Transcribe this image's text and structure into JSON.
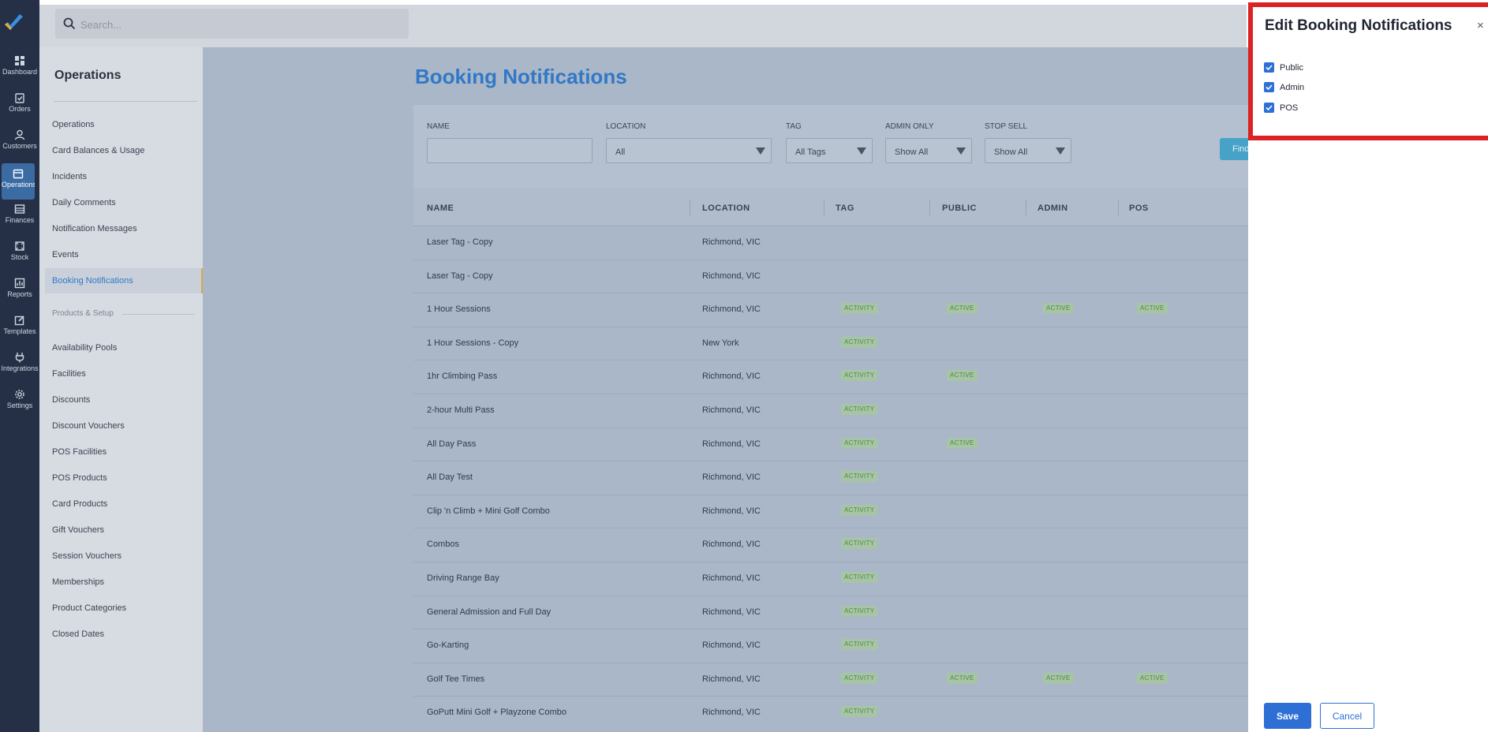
{
  "rail": {
    "items": [
      {
        "label": "Dashboard",
        "icon": "dashboard-icon"
      },
      {
        "label": "Orders",
        "icon": "orders-icon"
      },
      {
        "label": "Customers",
        "icon": "user-icon"
      },
      {
        "label": "Operations",
        "icon": "calendar-icon"
      },
      {
        "label": "Finances",
        "icon": "finance-icon"
      },
      {
        "label": "Stock",
        "icon": "stock-icon"
      },
      {
        "label": "Reports",
        "icon": "reports-icon"
      },
      {
        "label": "Templates",
        "icon": "edit-icon"
      },
      {
        "label": "Integrations",
        "icon": "plug-icon"
      },
      {
        "label": "Settings",
        "icon": "gear-icon"
      }
    ]
  },
  "search": {
    "placeholder": "Search..."
  },
  "subnav": {
    "title": "Operations",
    "items": [
      "Operations",
      "Card Balances & Usage",
      "Incidents",
      "Daily Comments",
      "Notification Messages",
      "Events",
      "Booking Notifications"
    ],
    "section_label": "Products & Setup",
    "setup_items": [
      "Availability Pools",
      "Facilities",
      "Discounts",
      "Discount Vouchers",
      "POS Facilities",
      "POS Products",
      "Card Products",
      "Gift Vouchers",
      "Session Vouchers",
      "Memberships",
      "Product Categories",
      "Closed Dates"
    ]
  },
  "main": {
    "title": "Booking Notifications",
    "filters": {
      "name_label": "NAME",
      "name_value": "",
      "location_label": "LOCATION",
      "location_value": "All",
      "tag_label": "TAG",
      "tag_value": "All Tags",
      "admin_only_label": "ADMIN ONLY",
      "admin_only_value": "Show All",
      "stop_sell_label": "STOP SELL",
      "stop_sell_value": "Show All",
      "find_label": "Find"
    },
    "columns": [
      "NAME",
      "LOCATION",
      "TAG",
      "PUBLIC",
      "ADMIN",
      "POS"
    ],
    "rows": [
      {
        "name": "Laser Tag - Copy",
        "location": "Richmond, VIC",
        "tag": "",
        "public": "",
        "admin": "",
        "pos": ""
      },
      {
        "name": "Laser Tag - Copy",
        "location": "Richmond, VIC",
        "tag": "",
        "public": "",
        "admin": "",
        "pos": ""
      },
      {
        "name": "1 Hour Sessions",
        "location": "Richmond, VIC",
        "tag": "ACTIVITY",
        "public": "ACTIVE",
        "admin": "ACTIVE",
        "pos": "ACTIVE"
      },
      {
        "name": "1 Hour Sessions - Copy",
        "location": "New York",
        "tag": "ACTIVITY",
        "public": "",
        "admin": "",
        "pos": ""
      },
      {
        "name": "1hr Climbing Pass",
        "location": "Richmond, VIC",
        "tag": "ACTIVITY",
        "public": "ACTIVE",
        "admin": "",
        "pos": ""
      },
      {
        "name": "2-hour Multi Pass",
        "location": "Richmond, VIC",
        "tag": "ACTIVITY",
        "public": "",
        "admin": "",
        "pos": ""
      },
      {
        "name": "All Day Pass",
        "location": "Richmond, VIC",
        "tag": "ACTIVITY",
        "public": "ACTIVE",
        "admin": "",
        "pos": ""
      },
      {
        "name": "All Day Test",
        "location": "Richmond, VIC",
        "tag": "ACTIVITY",
        "public": "",
        "admin": "",
        "pos": ""
      },
      {
        "name": "Clip 'n Climb + Mini Golf Combo",
        "location": "Richmond, VIC",
        "tag": "ACTIVITY",
        "public": "",
        "admin": "",
        "pos": ""
      },
      {
        "name": "Combos",
        "location": "Richmond, VIC",
        "tag": "ACTIVITY",
        "public": "",
        "admin": "",
        "pos": ""
      },
      {
        "name": "Driving Range Bay",
        "location": "Richmond, VIC",
        "tag": "ACTIVITY",
        "public": "",
        "admin": "",
        "pos": ""
      },
      {
        "name": "General Admission and Full Day",
        "location": "Richmond, VIC",
        "tag": "ACTIVITY",
        "public": "",
        "admin": "",
        "pos": ""
      },
      {
        "name": "Go-Karting",
        "location": "Richmond, VIC",
        "tag": "ACTIVITY",
        "public": "",
        "admin": "",
        "pos": ""
      },
      {
        "name": "Golf Tee Times",
        "location": "Richmond, VIC",
        "tag": "ACTIVITY",
        "public": "ACTIVE",
        "admin": "ACTIVE",
        "pos": "ACTIVE"
      },
      {
        "name": "GoPutt Mini Golf + Playzone Combo",
        "location": "Richmond, VIC",
        "tag": "ACTIVITY",
        "public": "",
        "admin": "",
        "pos": ""
      }
    ]
  },
  "panel": {
    "title": "Edit Booking Notifications",
    "close_glyph": "×",
    "options": [
      {
        "label": "Public",
        "checked": true
      },
      {
        "label": "Admin",
        "checked": true
      },
      {
        "label": "POS",
        "checked": true
      }
    ],
    "save_label": "Save",
    "cancel_label": "Cancel"
  },
  "colors": {
    "accent": "#2e6fd6",
    "title_blue": "#3178c6",
    "rail_bg": "#253046",
    "highlight_red": "#dc2323",
    "badge_green": "#4c8d43"
  }
}
